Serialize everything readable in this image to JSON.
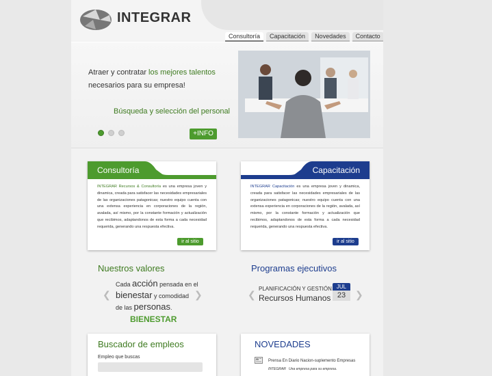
{
  "brand": {
    "name": "INTEGRAR"
  },
  "nav": [
    {
      "label": "Consultoría",
      "active": true
    },
    {
      "label": "Capacitación",
      "active": false
    },
    {
      "label": "Novedades",
      "active": false
    },
    {
      "label": "Contacto",
      "active": false
    }
  ],
  "hero": {
    "line1_pre": "Atraer y contratar ",
    "line1_highlight": "los mejores talentos",
    "line2": "necesarios para su empresa!",
    "subtitle": "Búsqueda y selección del personal",
    "info_button": "+INFO",
    "slides": 3,
    "active_slide": 1
  },
  "cards": {
    "consultoria": {
      "title": "Consultoría",
      "highlight": "INTEGRAR Recursos & Consultoría",
      "text": " es una empresa joven y dinamica, creada para satisfacer las necesidades empresariales de las organizaciones patagonicas; nuestro equipo cuenta con una extensa experiencia en corporaciones de la región, avalada, así mismo, por la constante formación y actualización que recibimos, adaptandonos de esta forma a cada necesidad requerida, generando una respuesta efectiva.",
      "button": "ir al sitio"
    },
    "capacitacion": {
      "title": "Capacitación",
      "highlight": "INTEGRAR Capacitación",
      "text": " es una empresa joven y dinamica, creada para satisfacer las necesidades empresariales de las organizaciones patagonicas; nuestro equipo cuenta con una extensa experiencia en corporaciones de la región, avalada, así mismo, por la constante formación y actualización que recibimos, adaptandonos de esta forma a cada necesidad requerida, generando una respuesta efectiva.",
      "button": "ir al sitio"
    }
  },
  "valores": {
    "title": "Nuestros valores",
    "w1": "Cada ",
    "w2": "acción",
    "w3": " pensada en el",
    "w4": "bienestar",
    "w5": " y comodidad",
    "w6": "de las ",
    "w7": "personas",
    "w8": ".",
    "keyword": "BIENESTAR"
  },
  "programas": {
    "title": "Programas ejecutivos",
    "line1": "PLANIFICACIÓN Y GESTIÓN DE",
    "line2": "Recursos Humanos",
    "month": "JUL",
    "day": "23"
  },
  "buscador": {
    "title": "Buscador de empleos",
    "field_label": "Empleo que buscas"
  },
  "novedades": {
    "title": "NOVEDADES",
    "item_title": "Prensa En Diario Nacion-suplemento Empresas",
    "item_src": "INTEGRAR",
    "item_excerpt": "Una empresa para su empresa."
  },
  "colors": {
    "green": "#4d9b2e",
    "blue": "#1d3d8e"
  }
}
